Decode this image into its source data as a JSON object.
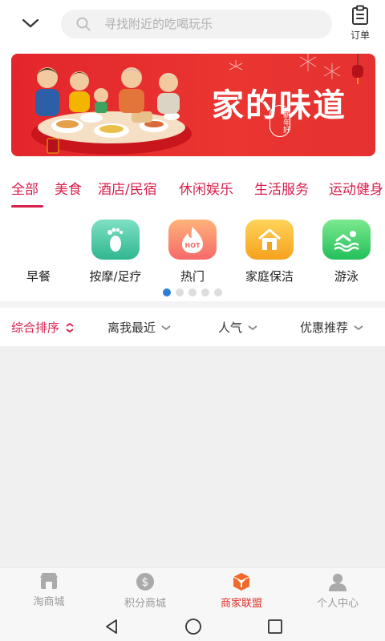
{
  "header": {
    "search_placeholder": "寻找附近的吃喝玩乐",
    "orders_label": "订单"
  },
  "banner": {
    "title": "家的味道",
    "stamp": "新年好"
  },
  "tabs": [
    "全部",
    "美食",
    "酒店/民宿",
    "休闲娱乐",
    "生活服务",
    "运动健身"
  ],
  "categories": [
    {
      "label": "早餐",
      "icon": "breakfast-icon"
    },
    {
      "label": "按摩/足疗",
      "icon": "footprint-icon"
    },
    {
      "label": "热门",
      "icon": "hot-icon"
    },
    {
      "label": "家庭保洁",
      "icon": "house-icon"
    },
    {
      "label": "游泳",
      "icon": "swim-icon"
    }
  ],
  "category_icon_text": "HOT",
  "pager": {
    "count": 5,
    "active": 0
  },
  "sort": [
    "综合排序",
    "离我最近",
    "人气",
    "优惠推荐"
  ],
  "bottom_nav": [
    {
      "label": "淘商城",
      "icon": "store-icon"
    },
    {
      "label": "积分商城",
      "icon": "coin-icon"
    },
    {
      "label": "商家联盟",
      "icon": "merchant-icon"
    },
    {
      "label": "个人中心",
      "icon": "person-icon"
    }
  ],
  "colors": {
    "accent": "#d81e4a",
    "banner_red": "#e53230",
    "pager_active": "#2a7fd8",
    "nav_active": "#e0312b"
  }
}
